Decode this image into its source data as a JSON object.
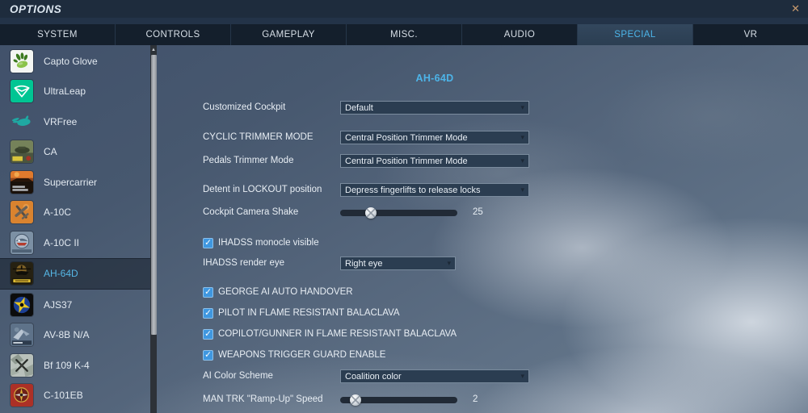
{
  "window": {
    "title": "OPTIONS"
  },
  "glyphs": {
    "close": "✕",
    "check": "✓",
    "dropdown_arrow": "▾",
    "scroll_up": "▲"
  },
  "colors": {
    "accent": "#4db4e8",
    "checkbox": "#3f97e0",
    "tab_selected_text": "#4cb4e8"
  },
  "tabs": [
    {
      "label": "SYSTEM",
      "selected": false
    },
    {
      "label": "CONTROLS",
      "selected": false
    },
    {
      "label": "GAMEPLAY",
      "selected": false
    },
    {
      "label": "MISC.",
      "selected": false
    },
    {
      "label": "AUDIO",
      "selected": false
    },
    {
      "label": "SPECIAL",
      "selected": true
    },
    {
      "label": "VR",
      "selected": false
    }
  ],
  "sidebar": {
    "items": [
      {
        "label": "Capto Glove",
        "icon": "capto-glove-icon",
        "selected": false
      },
      {
        "label": "UltraLeap",
        "icon": "ultraleap-icon",
        "selected": false
      },
      {
        "label": "VRFree",
        "icon": "vrfree-icon",
        "selected": false
      },
      {
        "label": "CA",
        "icon": "combined-arms-icon",
        "selected": false
      },
      {
        "label": "Supercarrier",
        "icon": "supercarrier-icon",
        "selected": false
      },
      {
        "label": "A-10C",
        "icon": "a10c-icon",
        "selected": false
      },
      {
        "label": "A-10C II",
        "icon": "a10c2-icon",
        "selected": false
      },
      {
        "label": "AH-64D",
        "icon": "ah64d-icon",
        "selected": true
      },
      {
        "label": "AJS37",
        "icon": "ajs37-icon",
        "selected": false
      },
      {
        "label": "AV-8B N/A",
        "icon": "av8b-icon",
        "selected": false
      },
      {
        "label": "Bf 109 K-4",
        "icon": "bf109-icon",
        "selected": false
      },
      {
        "label": "C-101EB",
        "icon": "c101eb-icon",
        "selected": false
      }
    ]
  },
  "main": {
    "title": "AH-64D",
    "settings": [
      {
        "type": "dropdown",
        "label": "Customized Cockpit",
        "value": "Default"
      },
      {
        "type": "dropdown",
        "label": "CYCLIC TRIMMER MODE",
        "value": "Central Position Trimmer Mode"
      },
      {
        "type": "dropdown",
        "label": "Pedals Trimmer Mode",
        "value": "Central Position Trimmer Mode"
      },
      {
        "type": "dropdown",
        "label": "Detent in LOCKOUT position",
        "value": "Depress fingerlifts to release locks"
      },
      {
        "type": "slider",
        "label": "Cockpit Camera Shake",
        "value": "25",
        "knob_left": "26%"
      },
      {
        "type": "checkbox",
        "label": "IHADSS monocle visible",
        "checked": true
      },
      {
        "type": "dropdown",
        "label": "IHADSS render eye",
        "value": "Right eye",
        "narrow": true
      },
      {
        "type": "checkbox",
        "label": "GEORGE AI AUTO HANDOVER",
        "checked": true
      },
      {
        "type": "checkbox",
        "label": "PILOT IN FLAME RESISTANT BALACLAVA",
        "checked": true
      },
      {
        "type": "checkbox",
        "label": "COPILOT/GUNNER IN FLAME RESISTANT BALACLAVA",
        "checked": true
      },
      {
        "type": "checkbox",
        "label": "WEAPONS TRIGGER GUARD ENABLE",
        "checked": true
      },
      {
        "type": "dropdown",
        "label": "AI Color Scheme",
        "value": "Coalition color"
      },
      {
        "type": "slider",
        "label": "MAN TRK \"Ramp-Up\" Speed",
        "value": "2",
        "knob_left": "13%"
      }
    ]
  }
}
